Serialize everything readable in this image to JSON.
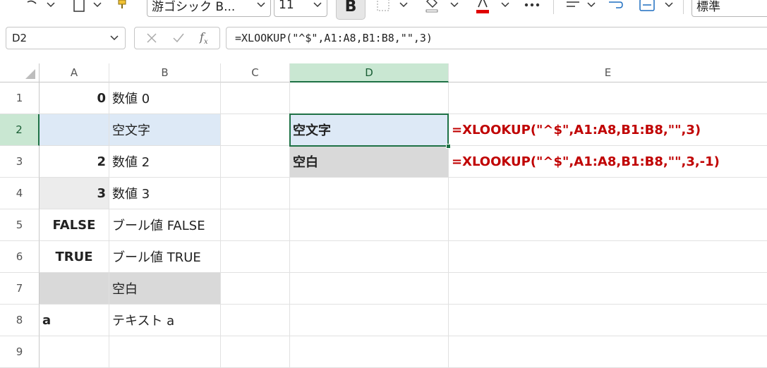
{
  "ribbon": {
    "font_name": "游ゴシック B...",
    "font_size": "11",
    "bold_label": "B",
    "number_format": "標準",
    "font_color": "#e00000"
  },
  "formula_bar": {
    "name_box": "D2",
    "formula": "=XLOOKUP(\"^$\",A1:A8,B1:B8,\"\",3)"
  },
  "columns": [
    "A",
    "B",
    "C",
    "D",
    "E"
  ],
  "rows": [
    "1",
    "2",
    "3",
    "4",
    "5",
    "6",
    "7",
    "8",
    "9"
  ],
  "selected": {
    "column": "D",
    "row": "2"
  },
  "cells": {
    "A1": "0",
    "B1": "数値 0",
    "A2": "",
    "B2": "空文字",
    "A3": "2",
    "B3": "数値 2",
    "A4": "3",
    "B4": "数値 3",
    "A5": "FALSE",
    "B5": "ブール値 FALSE",
    "A6": "TRUE",
    "B6": "ブール値 TRUE",
    "A7": "",
    "B7": "空白",
    "A8": "a",
    "B8": "テキスト a",
    "D2": "空文字",
    "D3": "空白",
    "E2": "=XLOOKUP(\"^$\",A1:A8,B1:B8,\"\",3)",
    "E3": "=XLOOKUP(\"^$\",A1:A8,B1:B8,\"\",3,-1)"
  },
  "colors": {
    "selection_green": "#1e7145",
    "header_highlight": "#c9e7d2",
    "blue_fill": "#dde9f6",
    "gray_fill": "#d9d9d9",
    "formula_text_red": "#c00000"
  }
}
